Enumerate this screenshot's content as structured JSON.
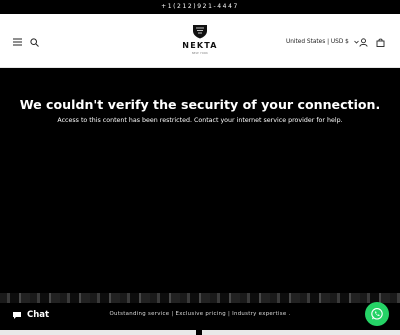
{
  "announcement": {
    "phone": "+1(212)921-4447"
  },
  "header": {
    "logo": {
      "word": "NEKTA",
      "sub": "NEW YORK"
    },
    "locale": "United States | USD $",
    "icons": [
      "menu-icon",
      "search-icon",
      "chevron-down-icon",
      "user-icon",
      "cart-icon"
    ]
  },
  "main": {
    "headline": "We couldn't verify the security of your connection.",
    "subtext": "Access to this content has been restricted. Contact your internet service provider for help."
  },
  "strip": {
    "tagline": "Outstanding service | Exclusive pricing | Industry expertise ."
  },
  "chat": {
    "label": "Chat"
  },
  "colors": {
    "whatsapp": "#25d366",
    "header_bg": "#ffffff",
    "page_bg": "#000000"
  }
}
